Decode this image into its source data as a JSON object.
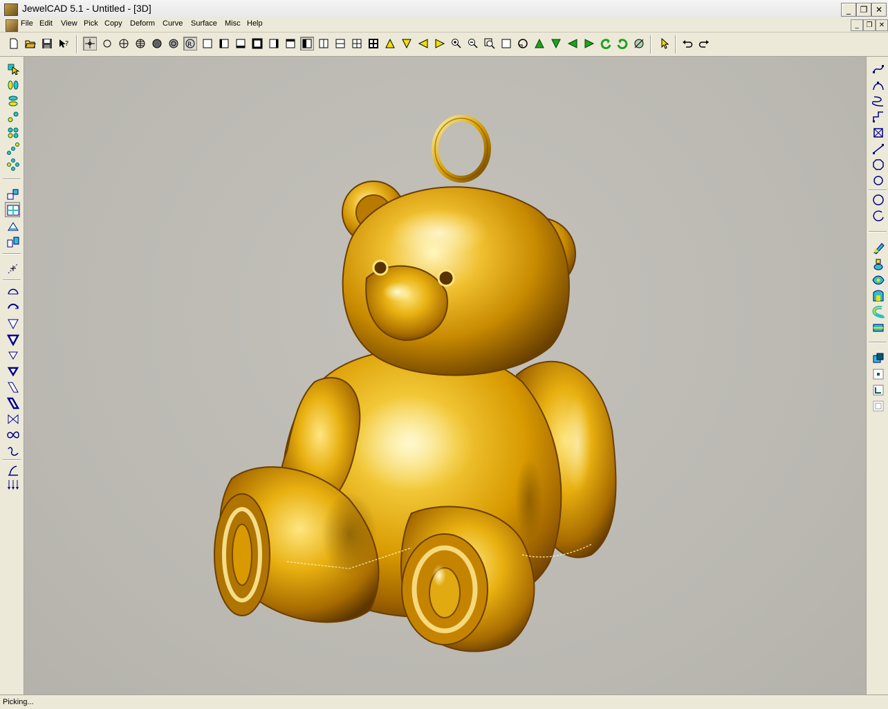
{
  "window": {
    "title": "JewelCAD 5.1 - Untitled - [3D]",
    "controls": {
      "minimize": "_",
      "maximize": "❐",
      "close": "✕"
    }
  },
  "menu": {
    "items": [
      "File",
      "Edit",
      "View",
      "Pick",
      "Copy",
      "Deform",
      "Curve",
      "Surface",
      "Misc",
      "Help"
    ],
    "doc_controls": {
      "minimize": "_",
      "restore": "❐",
      "close": "✕"
    }
  },
  "toolbar": {
    "icons": [
      "new-file",
      "open-file",
      "save",
      "help-pointer",
      "pick-point",
      "circle-empty",
      "sphere-grid",
      "sphere-grid-dense",
      "sphere-solid",
      "sphere-shaded",
      "render-view",
      "view-single",
      "view-left",
      "view-bottom",
      "view-front",
      "view-right",
      "view-top",
      "view-active",
      "view-split-vertical",
      "view-split-horizontal",
      "view-quad-a",
      "view-quad-b",
      "zoom-up",
      "zoom-down",
      "pan-left",
      "pan-right",
      "zoom-in",
      "zoom-out",
      "zoom-window",
      "zoom-all",
      "rotate-view",
      "green-up",
      "green-down",
      "green-left",
      "green-right",
      "green-rotate-ccw",
      "green-rotate-cw",
      "perspective",
      "select-arrow",
      "undo",
      "redo"
    ]
  },
  "left_toolbar": {
    "icons": [
      "pick-all",
      "group",
      "ellipsoid",
      "chain",
      "cluster",
      "linear-copy",
      "ring-copy",
      "transform",
      "plane",
      "cone",
      "mirror",
      "pattern",
      "line-curve",
      "arc",
      "triangle",
      "triangle-bold",
      "triangle-small",
      "triangle-small-bold",
      "parallelogram",
      "parallelogram-bold",
      "bowtie",
      "infinity",
      "wave",
      "scale-point",
      "arrows-down"
    ]
  },
  "right_toolbar": {
    "icons": [
      "curve-sweep",
      "curve-arc",
      "curve-s",
      "curve-extrude",
      "curve-box",
      "curve-line",
      "curve-octagon",
      "circle",
      "circle-large",
      "circle-open",
      "surface-pen",
      "surface-loft",
      "surface-rail",
      "surface-revolve",
      "surface-tube",
      "surface-cube",
      "boolean-union",
      "boolean-point",
      "boolean-corner",
      "boolean-frame"
    ]
  },
  "colors": {
    "gold_highlight": "#fff3b0",
    "gold_mid": "#e0a800",
    "gold_dark": "#7a4a00",
    "viewport_bg": "#bdbbb4"
  },
  "status": {
    "text": "Picking..."
  }
}
